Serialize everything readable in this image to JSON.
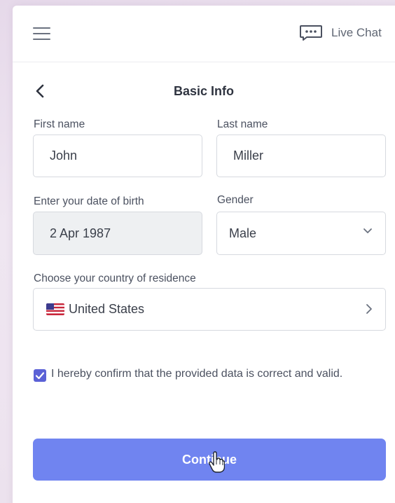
{
  "header": {
    "menu_icon": "hamburger-menu-icon",
    "live_chat_label": "Live Chat",
    "chat_icon": "chat-bubble-icon"
  },
  "page": {
    "title": "Basic Info",
    "back_icon": "chevron-left-icon"
  },
  "form": {
    "first_name": {
      "label": "First name",
      "value": "John"
    },
    "last_name": {
      "label": "Last name",
      "value": "Miller"
    },
    "date_of_birth": {
      "label": "Enter your date of birth",
      "value": "2 Apr 1987"
    },
    "gender": {
      "label": "Gender",
      "value": "Male"
    },
    "country": {
      "label": "Choose your country of residence",
      "value": "United States",
      "flag_icon": "us-flag-icon"
    },
    "confirm": {
      "checked": true,
      "text": "I hereby confirm that the provided data is correct and valid."
    },
    "continue_label": "Continue"
  },
  "colors": {
    "accent": "#5b61d6",
    "button": "#7084f0",
    "text": "#2f3440",
    "border": "#d6d9df",
    "readonly_bg": "#eef0f2"
  }
}
